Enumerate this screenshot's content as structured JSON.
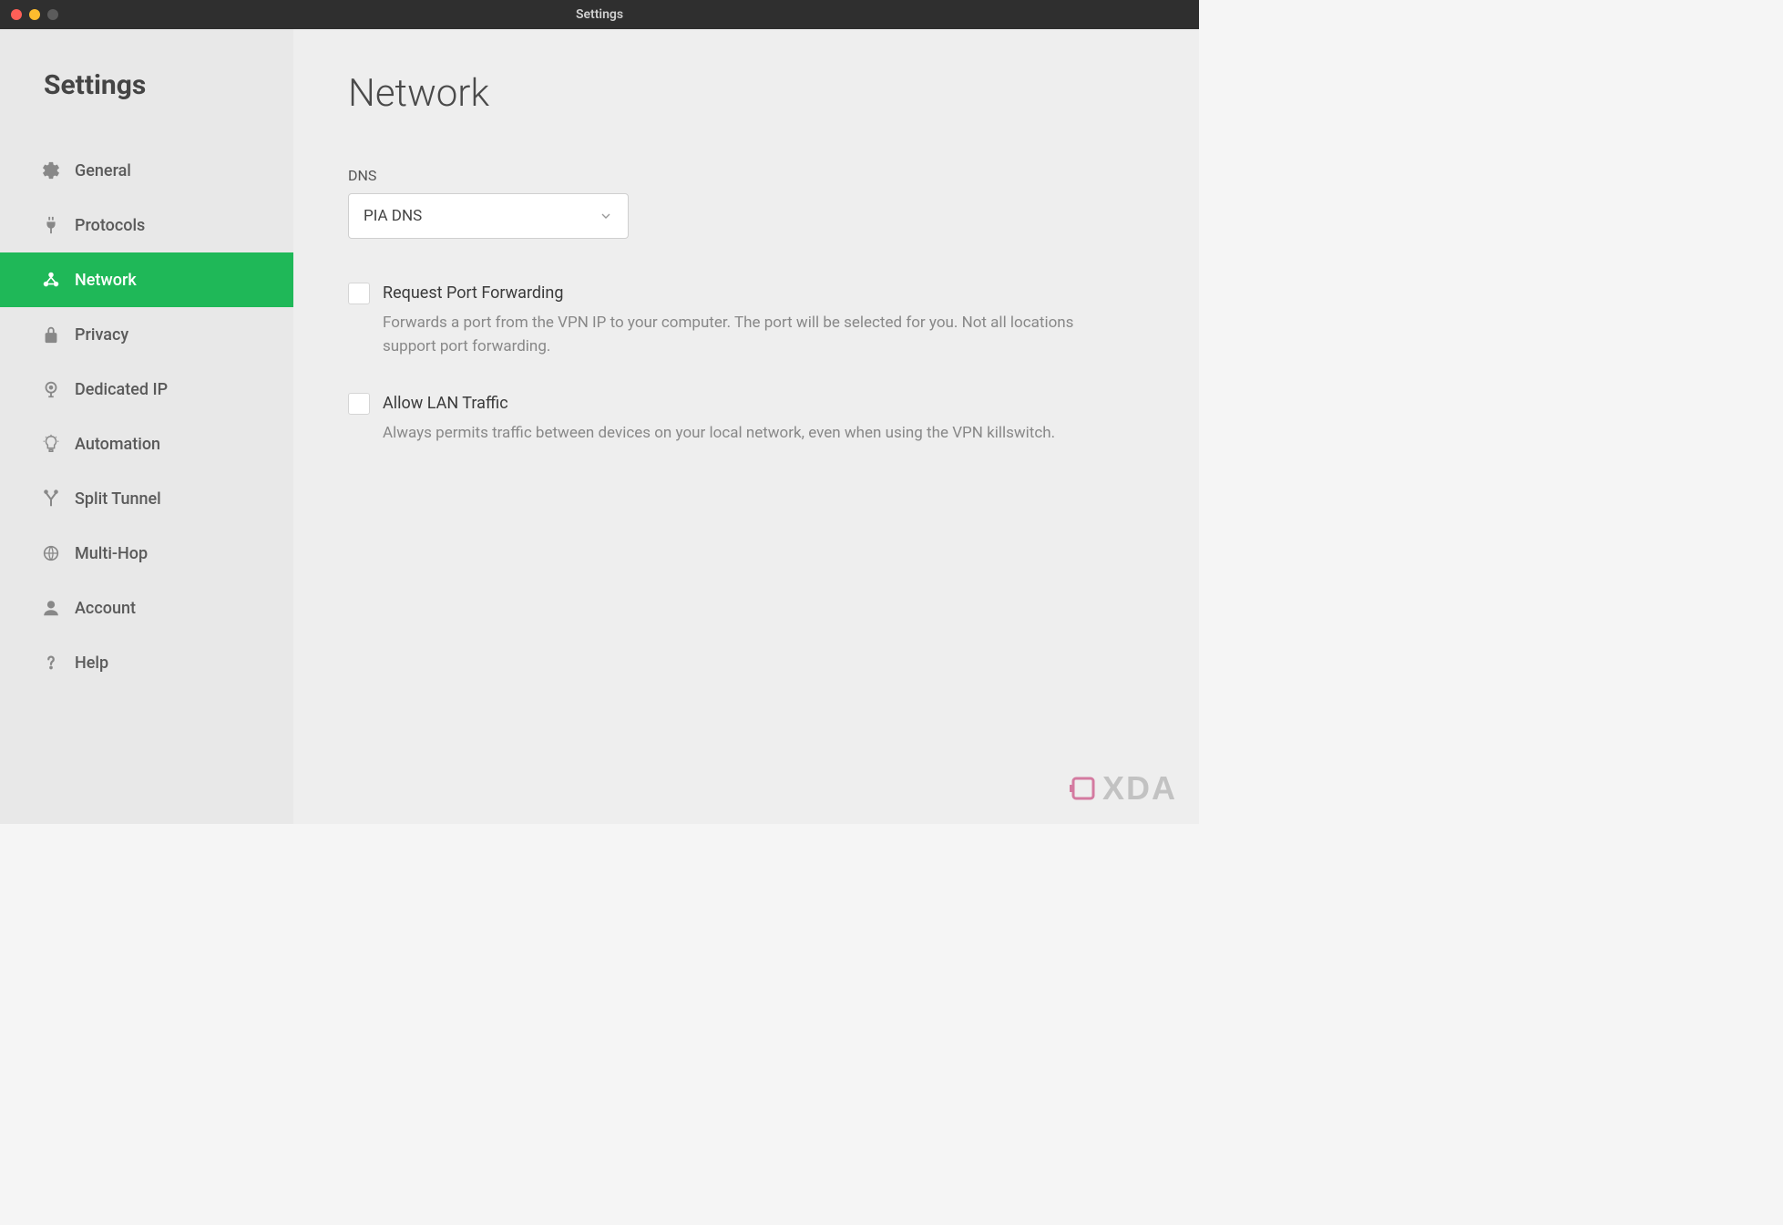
{
  "window": {
    "title": "Settings"
  },
  "sidebar": {
    "header": "Settings",
    "items": [
      {
        "key": "general",
        "label": "General"
      },
      {
        "key": "protocols",
        "label": "Protocols"
      },
      {
        "key": "network",
        "label": "Network",
        "active": true
      },
      {
        "key": "privacy",
        "label": "Privacy"
      },
      {
        "key": "dedicated-ip",
        "label": "Dedicated IP"
      },
      {
        "key": "automation",
        "label": "Automation"
      },
      {
        "key": "split-tunnel",
        "label": "Split Tunnel"
      },
      {
        "key": "multi-hop",
        "label": "Multi-Hop"
      },
      {
        "key": "account",
        "label": "Account"
      },
      {
        "key": "help",
        "label": "Help"
      }
    ]
  },
  "main": {
    "title": "Network",
    "dns": {
      "label": "DNS",
      "selected": "PIA DNS"
    },
    "options": [
      {
        "key": "request-port-forwarding",
        "title": "Request Port Forwarding",
        "desc": "Forwards a port from the VPN IP to your computer. The port will be selected for you. Not all locations support port forwarding.",
        "checked": false
      },
      {
        "key": "allow-lan-traffic",
        "title": "Allow LAN Traffic",
        "desc": "Always permits traffic between devices on your local network, even when using the VPN killswitch.",
        "checked": false
      }
    ]
  },
  "watermark": "XDA",
  "colors": {
    "accent": "#1fb858"
  }
}
